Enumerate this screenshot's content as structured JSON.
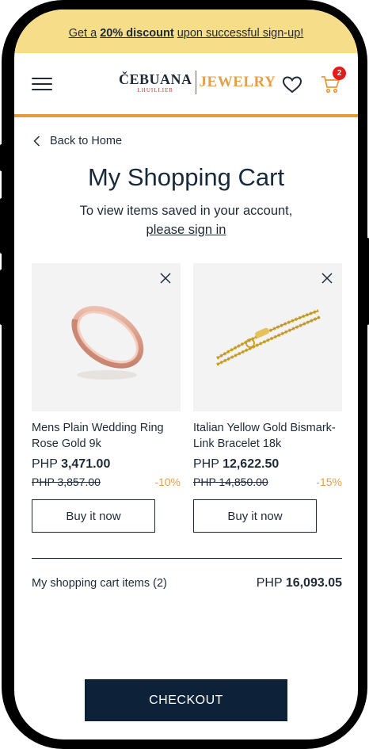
{
  "promo": {
    "prefix": "Get a ",
    "highlight": "20% discount",
    "suffix": " upon successful sign-up!"
  },
  "header": {
    "logo_main": "ČEBUANA",
    "logo_sub": "LHUILLIER",
    "logo_jewelry": "JEWELRY",
    "cart_count": "2",
    "icons": [
      "hamburger-menu-icon",
      "heart-icon",
      "cart-icon"
    ]
  },
  "nav": {
    "back_label": "Back to Home"
  },
  "page": {
    "title": "My Shopping Cart",
    "subtitle": "To view items saved in your account,",
    "signin_label": "please sign in"
  },
  "items": [
    {
      "name": "Mens Plain Wedding Ring Rose Gold 9k",
      "currency": "PHP",
      "price": "3,471.00",
      "old_price": "PHP 3,857.00",
      "discount": "-10%",
      "buy_label": "Buy it now",
      "image_icon": "rose-gold-ring-image"
    },
    {
      "name": "Italian Yellow Gold Bismark-Link Bracelet 18k",
      "currency": "PHP",
      "price": "12,622.50",
      "old_price": "PHP 14,850.00",
      "discount": "-15%",
      "buy_label": "Buy it now",
      "image_icon": "gold-bracelet-image"
    }
  ],
  "summary": {
    "label": "My shopping cart items (2)",
    "currency": "PHP",
    "total": "16,093.05"
  },
  "checkout_label": "CHECKOUT",
  "colors": {
    "promo_bg": "#f6dd8a",
    "accent": "#e29a3a",
    "navy": "#0d2238",
    "badge": "#e21b1b"
  }
}
